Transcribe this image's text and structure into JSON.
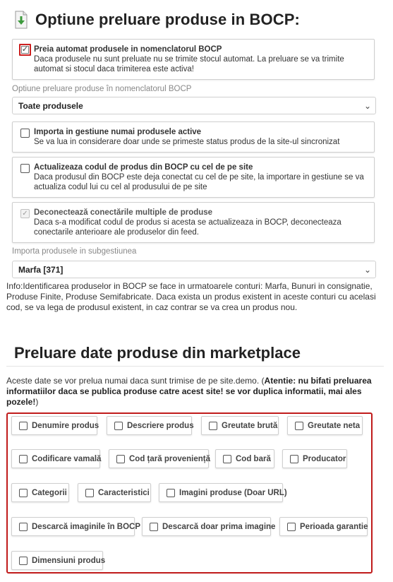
{
  "header": {
    "title": "Optiune preluare produse in BOCP:",
    "icon": "download-document-icon"
  },
  "auto_preia": {
    "title": "Preia automat produsele in nomenclatorul BOCP",
    "desc": "Daca produsele nu sunt preluate nu se trimite stocul automat. La preluare se va trimite automat si stocul daca trimiterea este activa!",
    "checked": true
  },
  "optiune_nomenclator": {
    "label": "Optiune preluare produse în nomenclatorul BOCP",
    "value": "Toate produsele"
  },
  "importa_active": {
    "title": "Importa in gestiune numai produsele active",
    "desc": "Se va lua in considerare doar unde se primeste status produs de la site-ul sincronizat",
    "checked": false
  },
  "actualizeaza_cod": {
    "title": "Actualizeaza codul de produs din BOCP cu cel de pe site",
    "desc": "Daca produsul din BOCP este deja conectat cu cel de pe site, la importare in gestiune se va actualiza codul lui cu cel al produsului de pe site",
    "checked": false
  },
  "deconecteaza": {
    "title": "Deconectează conectările multiple de produse",
    "desc": "Daca s-a modificat codul de produs si acesta se actualizeaza in BOCP, deconecteaza conectarile anterioare ale produselor din feed.",
    "checked": true,
    "disabled": true
  },
  "subgestiune": {
    "label": "Importa produsele in subgestiunea",
    "value": "Marfa [371]"
  },
  "info": "Info:Identificarea produselor in BOCP se face in urmatoarele conturi: Marfa, Bunuri in consignatie, Produse Finite, Produse Semifabricate. Daca exista un produs existent in aceste conturi cu acelasi cod, se va lega de produsul existent, in caz contrar se va crea un produs nou.",
  "marketplace": {
    "title": "Preluare date produse din marketplace",
    "note_start": "Aceste date se vor prelua numai daca sunt trimise de pe site.demo. (",
    "note_bold": "Atentie: nu bifati preluarea informatiilor daca se publica produse catre acest site! se vor duplica informatii, mai ales pozele!",
    "note_end": ")",
    "options": [
      "Denumire produs",
      "Descriere produs",
      "Greutate brută",
      "Greutate neta",
      "Codificare vamală",
      "Cod țară proveniență",
      "Cod bară",
      "Producator",
      "Categorii",
      "Caracteristici",
      "Imagini produse (Doar URL)",
      "Descarcă imaginile în BOCP",
      "Descarcă doar prima imagine",
      "Perioada garantie",
      "Dimensiuni produs"
    ]
  },
  "colors": {
    "highlight": "#c01b1b"
  }
}
